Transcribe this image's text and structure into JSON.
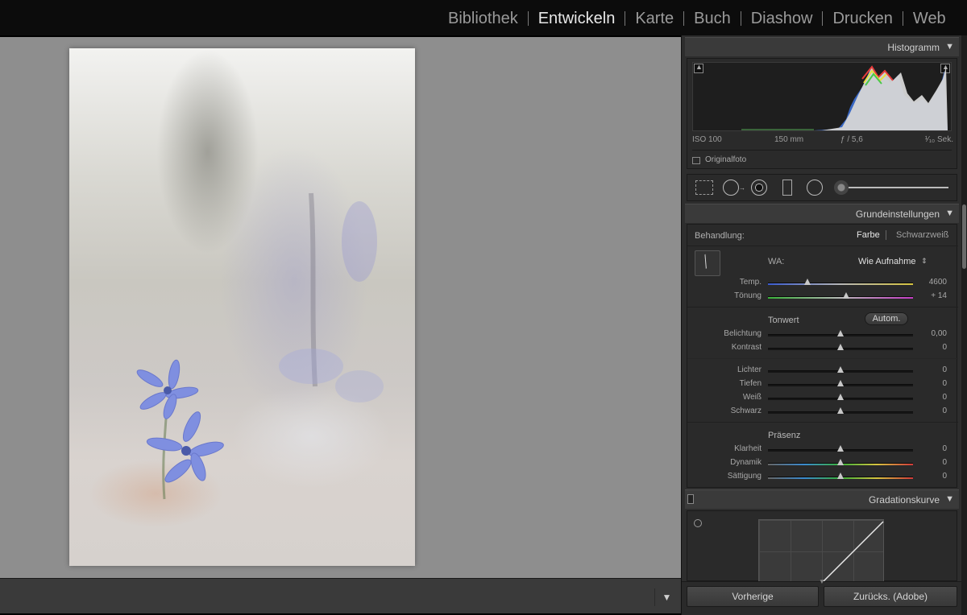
{
  "modules": [
    "Bibliothek",
    "Entwickeln",
    "Karte",
    "Buch",
    "Diashow",
    "Drucken",
    "Web"
  ],
  "active_module": "Entwickeln",
  "histogram": {
    "title": "Histogramm",
    "iso": "ISO 100",
    "focal": "150 mm",
    "aperture": "ƒ / 5,6",
    "shutter": "¹⁄₁₀ Sek.",
    "original_label": "Originalfoto"
  },
  "basic": {
    "title": "Grundeinstellungen",
    "treatment_label": "Behandlung:",
    "treatment_color": "Farbe",
    "treatment_bw": "Schwarzweiß",
    "wb_label": "WA:",
    "wb_value": "Wie Aufnahme",
    "temp_label": "Temp.",
    "temp_value": "4600",
    "tint_label": "Tönung",
    "tint_value": "+ 14",
    "tone_title": "Tonwert",
    "auto_label": "Autom.",
    "exposure_label": "Belichtung",
    "exposure_value": "0,00",
    "contrast_label": "Kontrast",
    "contrast_value": "0",
    "highlights_label": "Lichter",
    "highlights_value": "0",
    "shadows_label": "Tiefen",
    "shadows_value": "0",
    "whites_label": "Weiß",
    "whites_value": "0",
    "blacks_label": "Schwarz",
    "blacks_value": "0",
    "presence_title": "Präsenz",
    "clarity_label": "Klarheit",
    "clarity_value": "0",
    "vibrance_label": "Dynamik",
    "vibrance_value": "0",
    "saturation_label": "Sättigung",
    "saturation_value": "0"
  },
  "slider_levels": {
    "temp": 0.27,
    "tint": 0.54,
    "exposure": 0.5,
    "contrast": 0.5,
    "highlights": 0.5,
    "shadows": 0.5,
    "whites": 0.5,
    "blacks": 0.5,
    "clarity": 0.5,
    "vibrance": 0.5,
    "saturation": 0.5
  },
  "curve": {
    "title": "Gradationskurve"
  },
  "buttons": {
    "previous": "Vorherige",
    "reset": "Zurücks. (Adobe)"
  },
  "colors": {
    "panel_bg": "#2d2d2d",
    "header_bg": "#3a3a3a",
    "center_bg": "#8e8e8e",
    "topbar_bg": "#0c0c0c"
  }
}
